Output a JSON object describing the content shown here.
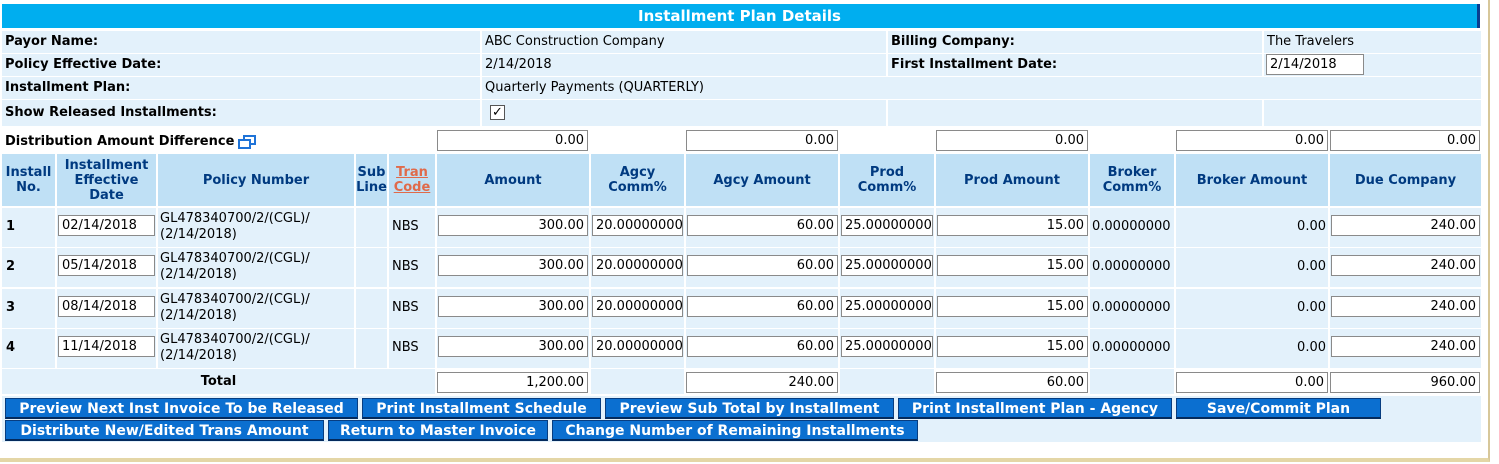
{
  "title": "Installment Plan Details",
  "info": {
    "payor_label": "Payor Name:",
    "payor_value": "ABC Construction Company",
    "billing_label": "Billing Company:",
    "billing_value": "The Travelers",
    "policy_eff_label": "Policy Effective Date:",
    "policy_eff_value": "2/14/2018",
    "first_inst_label": "First Installment Date:",
    "first_inst_value": "2/14/2018",
    "plan_label": "Installment Plan:",
    "plan_value": "Quarterly Payments (QUARTERLY)",
    "show_released_label": "Show Released Installments:",
    "show_released_checked": true,
    "checkmark": "✓"
  },
  "distribution": {
    "label": "Distribution Amount Difference",
    "icon": "window-restore-icon",
    "amount": "0.00",
    "agcy_amount": "0.00",
    "prod_amount": "0.00",
    "broker_amount": "0.00",
    "due_company": "0.00"
  },
  "columns": {
    "install_no": "Install No.",
    "inst_eff_date": "Installment Effective Date",
    "policy_number": "Policy Number",
    "sub_line": "Sub Line",
    "tran_code": "Tran Code",
    "amount": "Amount",
    "agcy_comm": "Agcy Comm%",
    "agcy_amount": "Agcy Amount",
    "prod_comm": "Prod Comm%",
    "prod_amount": "Prod Amount",
    "broker_comm": "Broker Comm%",
    "broker_amount": "Broker Amount",
    "due_company": "Due Company"
  },
  "rows": [
    {
      "no": "1",
      "date": "02/14/2018",
      "policy_line1": "GL478340700/2/(CGL)/",
      "policy_line2": "(2/14/2018)",
      "tran": "NBS",
      "amount": "300.00",
      "agcy_comm": "20.00000000",
      "agcy_amount": "60.00",
      "prod_comm": "25.00000000",
      "prod_amount": "15.00",
      "broker_comm": "0.00000000",
      "broker_amount": "0.00",
      "due": "240.00"
    },
    {
      "no": "2",
      "date": "05/14/2018",
      "policy_line1": "GL478340700/2/(CGL)/",
      "policy_line2": "(2/14/2018)",
      "tran": "NBS",
      "amount": "300.00",
      "agcy_comm": "20.00000000",
      "agcy_amount": "60.00",
      "prod_comm": "25.00000000",
      "prod_amount": "15.00",
      "broker_comm": "0.00000000",
      "broker_amount": "0.00",
      "due": "240.00"
    },
    {
      "no": "3",
      "date": "08/14/2018",
      "policy_line1": "GL478340700/2/(CGL)/",
      "policy_line2": "(2/14/2018)",
      "tran": "NBS",
      "amount": "300.00",
      "agcy_comm": "20.00000000",
      "agcy_amount": "60.00",
      "prod_comm": "25.00000000",
      "prod_amount": "15.00",
      "broker_comm": "0.00000000",
      "broker_amount": "0.00",
      "due": "240.00"
    },
    {
      "no": "4",
      "date": "11/14/2018",
      "policy_line1": "GL478340700/2/(CGL)/",
      "policy_line2": "(2/14/2018)",
      "tran": "NBS",
      "amount": "300.00",
      "agcy_comm": "20.00000000",
      "agcy_amount": "60.00",
      "prod_comm": "25.00000000",
      "prod_amount": "15.00",
      "broker_comm": "0.00000000",
      "broker_amount": "0.00",
      "due": "240.00"
    }
  ],
  "totals": {
    "label": "Total",
    "amount": "1,200.00",
    "agcy_amount": "240.00",
    "prod_amount": "60.00",
    "broker_amount": "0.00",
    "due_company": "960.00"
  },
  "buttons": {
    "preview_next": "Preview Next Inst Invoice To be Released",
    "print_schedule": "Print Installment Schedule",
    "preview_subtotal": "Preview Sub Total by Installment",
    "print_plan_agency": "Print Installment Plan - Agency",
    "save_commit": "Save/Commit Plan",
    "distribute": "Distribute New/Edited Trans Amount",
    "return_master": "Return to Master Invoice",
    "change_remaining": "Change Number of Remaining Installments"
  },
  "colors": {
    "title_bar": "#00aeef",
    "button": "#0b6fd0",
    "header_bg": "#bfe0f5",
    "row_bg": "#e3f1fb",
    "header_text": "#003a80",
    "tran_code_link": "#e06a4a"
  }
}
